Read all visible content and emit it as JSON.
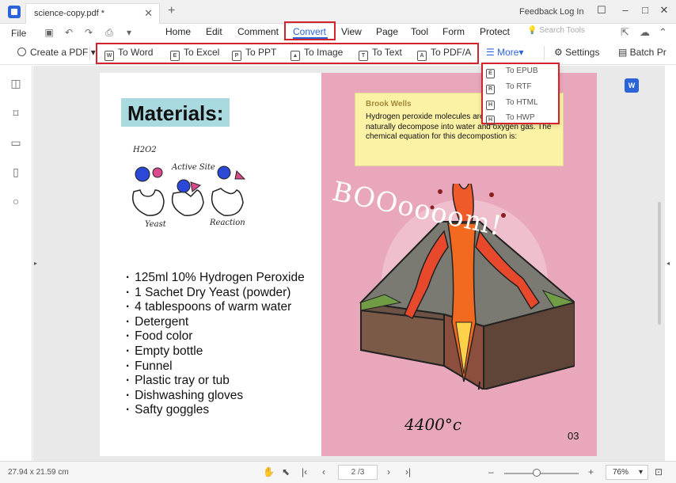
{
  "titlebar": {
    "tab_title": "science-copy.pdf *",
    "tab_close_icon": "close-icon",
    "new_tab_icon": "plus-icon",
    "feedback": "Feedback",
    "login": "Log In"
  },
  "menubar": {
    "file": "File",
    "quick_icons": [
      "save-icon",
      "undo-icon",
      "redo-icon",
      "print-icon",
      "dropdown-icon"
    ],
    "items": [
      {
        "label": "Home"
      },
      {
        "label": "Edit"
      },
      {
        "label": "Comment"
      },
      {
        "label": "Convert",
        "active": true
      },
      {
        "label": "View"
      },
      {
        "label": "Page"
      },
      {
        "label": "Tool"
      },
      {
        "label": "Form"
      },
      {
        "label": "Protect"
      }
    ],
    "search_placeholder": "Search Tools",
    "right_icons": [
      "share-icon",
      "upload-icon",
      "chevron-up-icon"
    ]
  },
  "toolbar": {
    "create_pdf": "Create a PDF",
    "convert_items": [
      {
        "label": "To Word",
        "icon": "W"
      },
      {
        "label": "To Excel",
        "icon": "E"
      },
      {
        "label": "To PPT",
        "icon": "P"
      },
      {
        "label": "To Image",
        "icon": "▲"
      },
      {
        "label": "To Text",
        "icon": "T"
      },
      {
        "label": "To PDF/A",
        "icon": "A"
      }
    ],
    "more": "More",
    "settings": "Settings",
    "batch": "Batch Pr"
  },
  "more_dropdown": {
    "items": [
      {
        "label": "To EPUB",
        "icon": "E"
      },
      {
        "label": "To RTF",
        "icon": "R"
      },
      {
        "label": "To HTML",
        "icon": "H"
      },
      {
        "label": "To HWP",
        "icon": "H"
      }
    ]
  },
  "sidebar": {
    "icons": [
      "thumbnails-icon",
      "bookmark-icon",
      "comment-icon",
      "attachment-icon",
      "search-icon"
    ]
  },
  "page": {
    "materials_title": "Materials:",
    "sketch_labels": {
      "h2o2": "H2O2",
      "active_site": "Active Site",
      "yeast": "Yeast",
      "reaction": "Reaction"
    },
    "materials": [
      "125ml 10% Hydrogen Peroxide",
      "1 Sachet Dry Yeast (powder)",
      "4 tablespoons of warm water",
      "Detergent",
      "Food color",
      "Empty bottle",
      "Funnel",
      "Plastic tray or tub",
      "Dishwashing gloves",
      "Safty goggles"
    ],
    "boom_text": "BOOoooom!",
    "temperature": "4400°c",
    "page_number": "03",
    "note": {
      "author": "Brook Wells",
      "text": "Hydrogen peroxide molecules are unstable and naturally decompose into water and oxygen gas. The chemical equation for this decompostion is:"
    }
  },
  "statusbar": {
    "page_size": "27.94 x 21.59 cm",
    "page_indicator": "2 /3",
    "zoom": "76%",
    "zoom_level": 0.38
  }
}
